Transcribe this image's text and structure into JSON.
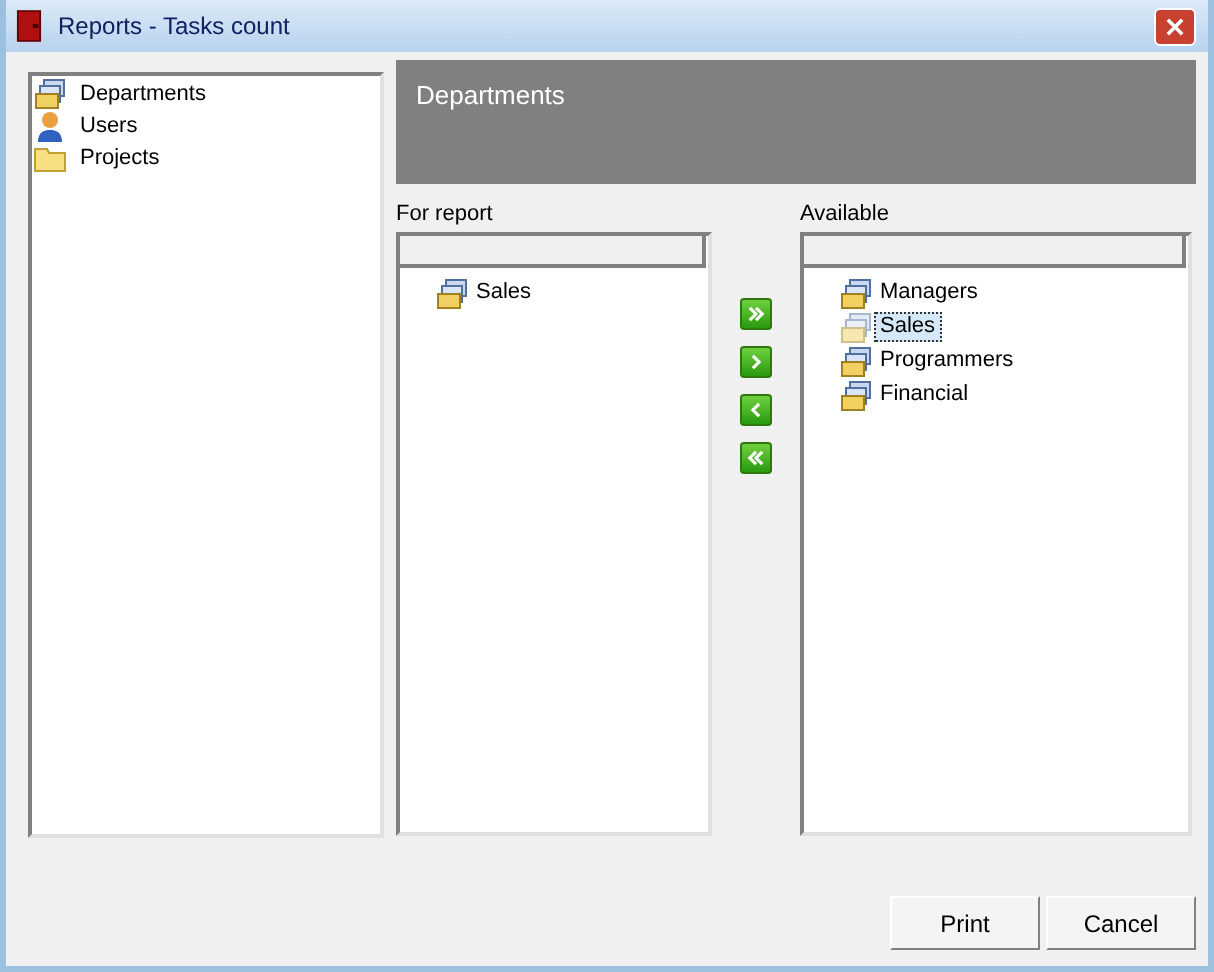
{
  "window": {
    "title": "Reports - Tasks count"
  },
  "sidebar": {
    "items": [
      {
        "label": "Departments",
        "kind": "stack",
        "selected": false
      },
      {
        "label": "Users",
        "kind": "user",
        "selected": false
      },
      {
        "label": "Projects",
        "kind": "folder",
        "selected": false
      }
    ]
  },
  "header": {
    "title": "Departments"
  },
  "for_report": {
    "label": "For report",
    "items": [
      {
        "label": "Sales",
        "selected": false
      }
    ]
  },
  "available": {
    "label": "Available",
    "items": [
      {
        "label": "Managers",
        "selected": false
      },
      {
        "label": "Sales",
        "selected": true
      },
      {
        "label": "Programmers",
        "selected": false
      },
      {
        "label": "Financial",
        "selected": false
      }
    ]
  },
  "buttons": [
    "Print",
    "Cancel"
  ]
}
